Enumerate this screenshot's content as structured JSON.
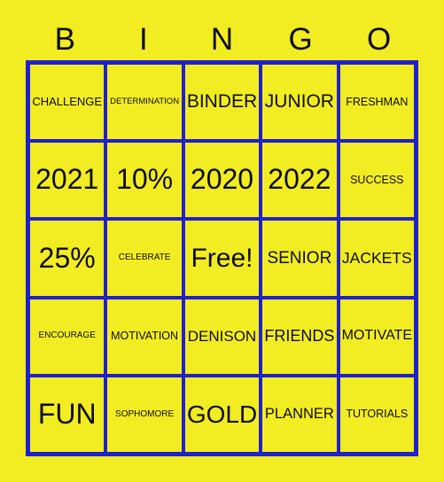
{
  "card": {
    "title": "BINGO",
    "header_letters": [
      "B",
      "I",
      "N",
      "G",
      "O"
    ],
    "colors": {
      "background": "#f2ec22",
      "grid_line": "#2020cc",
      "text": "#0d0d0d"
    },
    "free_space": "Free!",
    "grid": [
      [
        {
          "label": "CHALLENGE",
          "size": "sm"
        },
        {
          "label": "DETERMINATION",
          "size": "xxs"
        },
        {
          "label": "BINDER",
          "size": "lg"
        },
        {
          "label": "JUNIOR",
          "size": "lg"
        },
        {
          "label": "FRESHMAN",
          "size": "xs"
        }
      ],
      [
        {
          "label": "2021",
          "size": "xl"
        },
        {
          "label": "10%",
          "size": "xl"
        },
        {
          "label": "2020",
          "size": "xl"
        },
        {
          "label": "2022",
          "size": "xl"
        },
        {
          "label": "SUCCESS",
          "size": "xs"
        }
      ],
      [
        {
          "label": "25%",
          "size": "xl"
        },
        {
          "label": "CELEBRATE",
          "size": "xxs"
        },
        {
          "label": "Free!",
          "size": "free"
        },
        {
          "label": "SENIOR",
          "size": "md"
        },
        {
          "label": "JACKETS",
          "size": "md"
        }
      ],
      [
        {
          "label": "ENCOURAGE",
          "size": "xxs"
        },
        {
          "label": "MOTIVATION",
          "size": "xs"
        },
        {
          "label": "DENISON",
          "size": "md"
        },
        {
          "label": "FRIENDS",
          "size": "md"
        },
        {
          "label": "MOTIVATE",
          "size": "md"
        }
      ],
      [
        {
          "label": "FUN",
          "size": "xl"
        },
        {
          "label": "SOPHOMORE",
          "size": "xxs"
        },
        {
          "label": "GOLD",
          "size": "xl"
        },
        {
          "label": "PLANNER",
          "size": "md"
        },
        {
          "label": "TUTORIALS",
          "size": "xs"
        }
      ]
    ]
  }
}
